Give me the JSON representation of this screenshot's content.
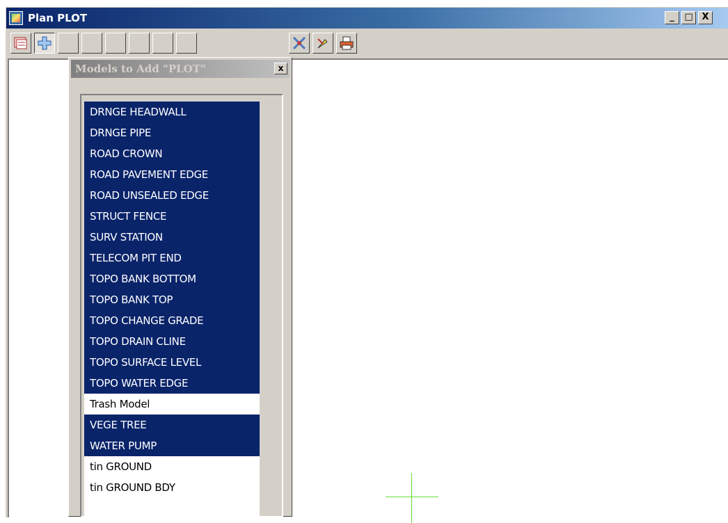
{
  "window": {
    "title": "Plan PLOT",
    "controls": {
      "minimize": "_",
      "maximize": "□",
      "close": "X"
    }
  },
  "toolbar": {
    "buttons": [
      {
        "name": "plot-layers-icon",
        "pressed": false
      },
      {
        "name": "add-model-icon",
        "pressed": true
      },
      {
        "name": "blank-icon",
        "pressed": false
      },
      {
        "name": "zoom-icon",
        "pressed": false
      },
      {
        "name": "move-icon",
        "pressed": false
      },
      {
        "name": "zoom-in-icon",
        "pressed": false
      },
      {
        "name": "zoom-out-icon",
        "pressed": false
      },
      {
        "name": "pan-icon",
        "pressed": false
      },
      {
        "name": "delete-icon",
        "pressed": false
      },
      {
        "name": "pick-icon",
        "pressed": false
      },
      {
        "name": "print-icon",
        "pressed": false
      }
    ]
  },
  "popup": {
    "title": "Models to Add \"PLOT\"",
    "close_label": "x",
    "items": [
      {
        "label": "DRNGE HEADWALL",
        "selected": true
      },
      {
        "label": "DRNGE PIPE",
        "selected": true
      },
      {
        "label": "ROAD CROWN",
        "selected": true
      },
      {
        "label": "ROAD PAVEMENT EDGE",
        "selected": true
      },
      {
        "label": "ROAD UNSEALED EDGE",
        "selected": true
      },
      {
        "label": "STRUCT FENCE",
        "selected": true
      },
      {
        "label": "SURV STATION",
        "selected": true
      },
      {
        "label": "TELECOM PIT END",
        "selected": true
      },
      {
        "label": "TOPO BANK BOTTOM",
        "selected": true
      },
      {
        "label": "TOPO BANK TOP",
        "selected": true
      },
      {
        "label": "TOPO CHANGE GRADE",
        "selected": true
      },
      {
        "label": "TOPO DRAIN CLINE",
        "selected": true
      },
      {
        "label": "TOPO SURFACE LEVEL",
        "selected": true
      },
      {
        "label": "TOPO WATER EDGE",
        "selected": true
      },
      {
        "label": "Trash Model",
        "selected": false
      },
      {
        "label": "VEGE TREE",
        "selected": true
      },
      {
        "label": "WATER PUMP",
        "selected": true
      },
      {
        "label": "tin GROUND",
        "selected": false
      },
      {
        "label": "tin GROUND BDY",
        "selected": false
      }
    ]
  },
  "colors": {
    "selection": "#0a246a",
    "crosshair": "#66dd33",
    "titlebar_active": "#0a246a"
  }
}
